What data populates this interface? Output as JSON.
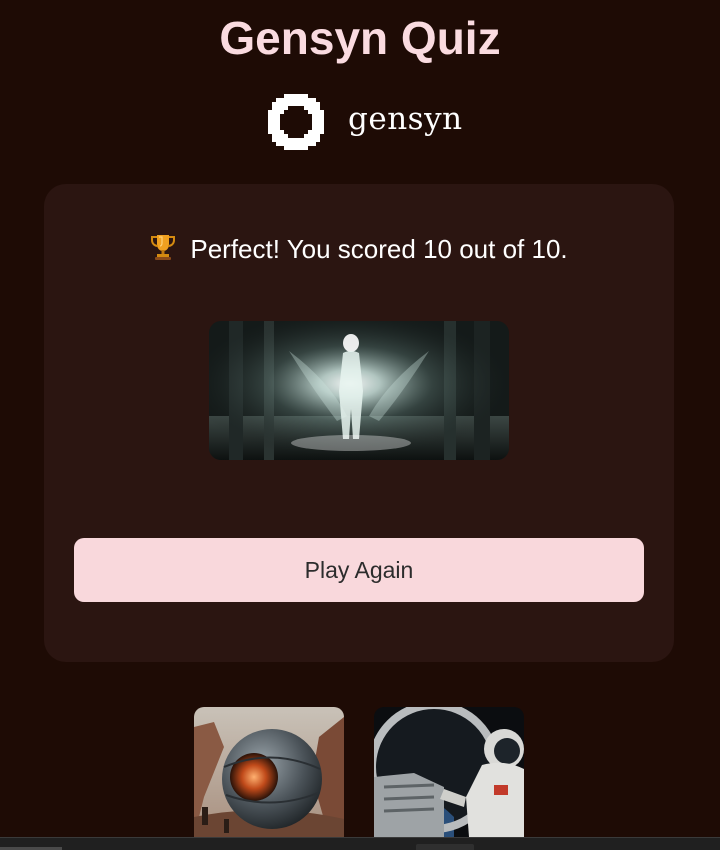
{
  "header": {
    "title": "Gensyn Quiz",
    "logo_text": "gensyn"
  },
  "result_card": {
    "trophy_emoji": "🏆",
    "message": "Perfect! You scored 10 out of 10.",
    "score": 10,
    "total": 10,
    "play_again_label": "Play Again"
  },
  "thumbnails": [
    {
      "name": "thumbnail-sphere-canyon"
    },
    {
      "name": "thumbnail-astronaut"
    }
  ],
  "colors": {
    "background": "#1e0b05",
    "card": "#2b1511",
    "title": "#fadbe0",
    "button": "#f9d8dc"
  }
}
